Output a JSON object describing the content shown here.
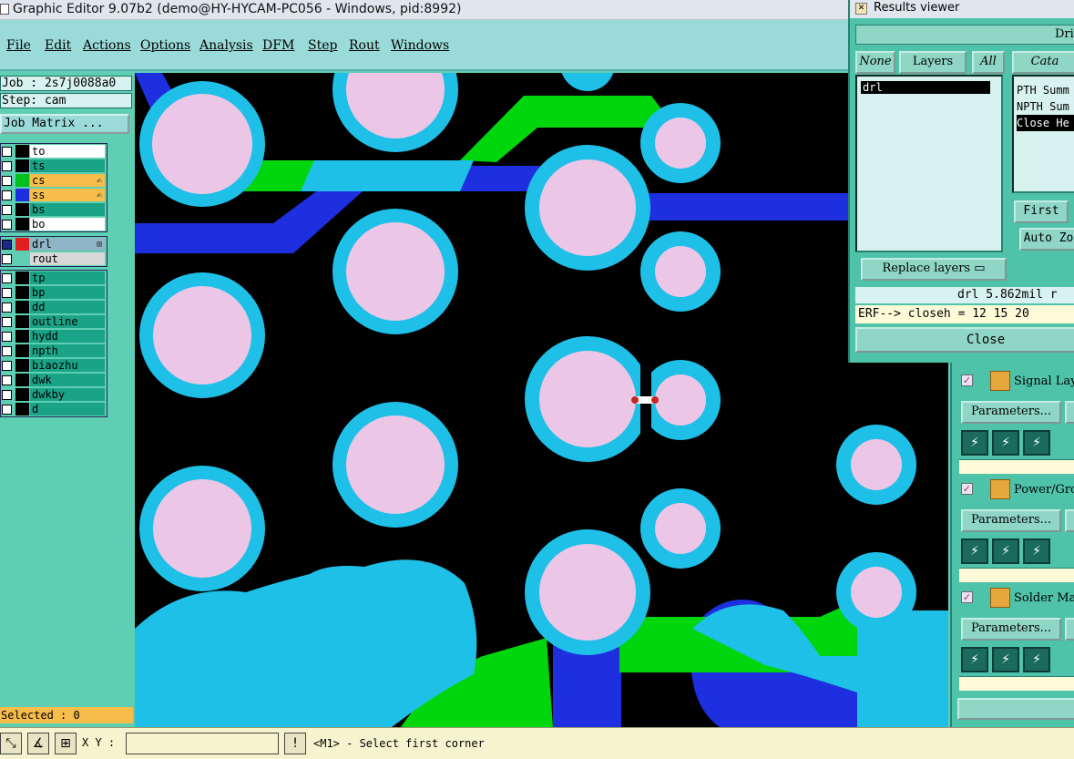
{
  "window": {
    "title": "Graphic Editor 9.07b2 (demo@HY-HYCAM-PC056 - Windows, pid:8992)"
  },
  "menu": [
    "File",
    "Edit",
    "Actions",
    "Options",
    "Analysis",
    "DFM",
    "Step",
    "Rout",
    "Windows"
  ],
  "job": {
    "job_line": "Job : 2s7j0088a0",
    "step_line": "Step: cam",
    "matrix_button": "Job Matrix ..."
  },
  "layers_top": [
    {
      "name": "to",
      "color": "#000000",
      "bg": "#ffffff"
    },
    {
      "name": "ts",
      "color": "#000000",
      "bg": "#1aa387"
    },
    {
      "name": "cs",
      "color": "#00c020",
      "bg": "#f7bd4a",
      "mark": "✍"
    },
    {
      "name": "ss",
      "color": "#1e2fe0",
      "bg": "#f7bd4a",
      "mark": "✍"
    },
    {
      "name": "bs",
      "color": "#000000",
      "bg": "#1aa387"
    },
    {
      "name": "bo",
      "color": "#000000",
      "bg": "#ffffff"
    }
  ],
  "layers_mid": [
    {
      "name": "drl",
      "color": "#e02020",
      "bg": "#8fb6c7",
      "mark": "⊞",
      "cb_active": true
    },
    {
      "name": "rout",
      "color": "#5fcfb4",
      "bg": "#d8d8d8"
    }
  ],
  "layers_bottom": [
    "tp",
    "bp",
    "dd",
    "outline",
    "hydd",
    "npth",
    "biaozhu",
    "dwk",
    "dwkby",
    "d"
  ],
  "selected": "Selected : 0",
  "status": {
    "xy_label": "X Y :",
    "xy_value": "",
    "hint": "<M1> - Select first corner"
  },
  "results_viewer": {
    "title": "Results viewer",
    "drill_header": "Drill",
    "buttons": {
      "none": "None",
      "layers": "Layers",
      "all": "All",
      "replace": "Replace layers",
      "first": "First",
      "auto_zoom": "Auto Zo",
      "cat": "Cata",
      "close": "Close"
    },
    "list_items": [
      "drl"
    ],
    "categories": [
      "PTH Summ",
      "NPTH Sum",
      "Close He"
    ],
    "erf_value": "drl 5.862mil  r",
    "erf_line": "ERF--> closeh = 12 15 20"
  },
  "analysis_sections": [
    {
      "label": "Signal Lay",
      "params": "Parameters..."
    },
    {
      "label": "Power/Grou",
      "params": "Parameters..."
    },
    {
      "label": "Solder Mas",
      "params": "Parameters..."
    }
  ],
  "colors": {
    "copper_pad": "#1ec0e8",
    "drill": "#ecc6e6",
    "signal_trace": "#00d60e",
    "ss_trace": "#1e2fe0",
    "background": "#000000"
  }
}
